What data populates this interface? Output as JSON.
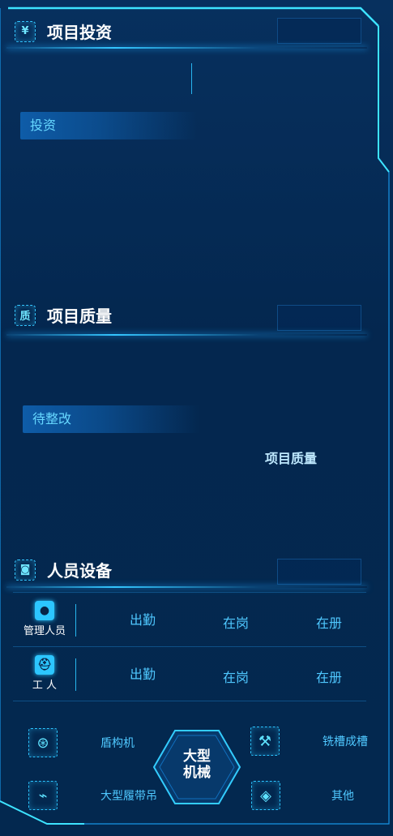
{
  "investment": {
    "title": "项目投资",
    "icon": "yen-icon",
    "pill": "投资"
  },
  "quality": {
    "title": "项目质量",
    "icon": "quality-icon",
    "pill": "待整改",
    "center_label": "项目质量"
  },
  "personnel": {
    "title": "人员设备",
    "icon": "people-icon",
    "rows": [
      {
        "role": "管理人员",
        "icon": "manager-icon",
        "metrics": [
          "出勤",
          "在岗",
          "在册"
        ]
      },
      {
        "role": "工 人",
        "icon": "worker-icon",
        "metrics": [
          "出勤",
          "在岗",
          "在册"
        ]
      }
    ]
  },
  "equipment": {
    "center": "大型\n机械",
    "items": [
      {
        "label": "盾构机",
        "icon": "shield-machine-icon"
      },
      {
        "label": "铣槽成槽",
        "icon": "crane-icon"
      },
      {
        "label": "大型履带吊",
        "icon": "crawler-crane-icon"
      },
      {
        "label": "其他",
        "icon": "layers-icon"
      }
    ]
  },
  "colors": {
    "accent": "#34c6ff",
    "bg": "#03234a"
  }
}
